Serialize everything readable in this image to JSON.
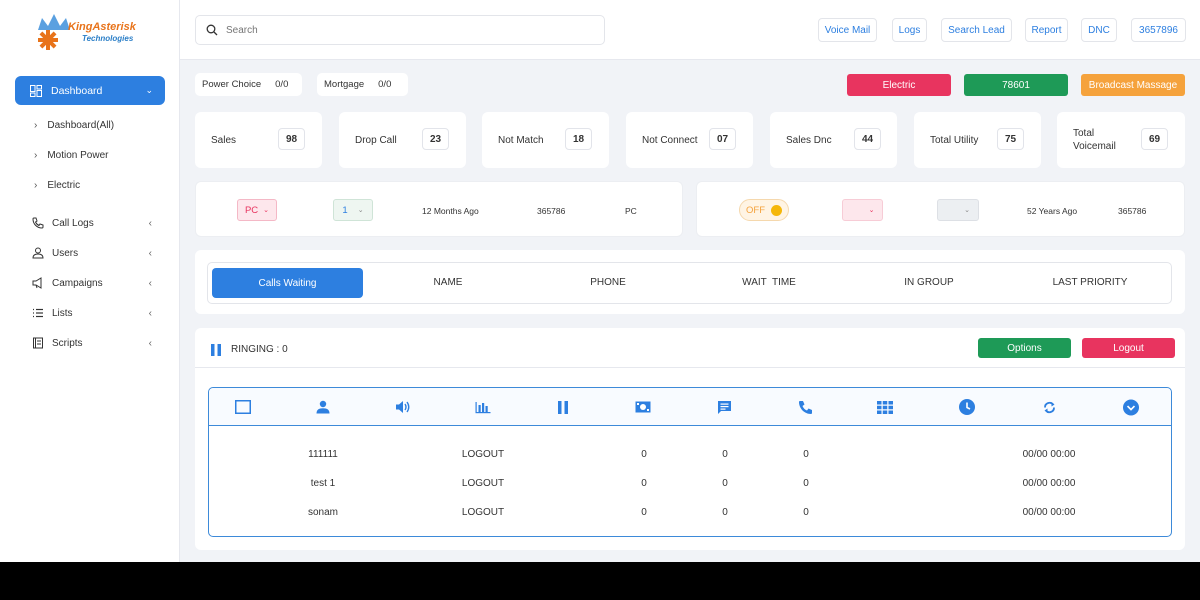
{
  "brand": {
    "name": "KingAsterisk",
    "sub": "Technologies"
  },
  "sidebar": {
    "active": {
      "label": "Dashboard"
    },
    "sub_items": [
      {
        "label": "Dashboard(All)"
      },
      {
        "label": "Motion Power"
      },
      {
        "label": "Electric"
      }
    ],
    "items": [
      {
        "label": "Call Logs",
        "icon": "phone-icon"
      },
      {
        "label": "Users",
        "icon": "user-icon"
      },
      {
        "label": "Campaigns",
        "icon": "megaphone-icon"
      },
      {
        "label": "Lists",
        "icon": "list-icon"
      },
      {
        "label": "Scripts",
        "icon": "script-icon"
      }
    ]
  },
  "topbar": {
    "search_placeholder": "Search",
    "buttons": [
      {
        "label": "Voice Mail"
      },
      {
        "label": "Logs"
      },
      {
        "label": "Search Lead"
      },
      {
        "label": "Report"
      },
      {
        "label": "DNC"
      },
      {
        "label": "3657896"
      }
    ]
  },
  "queues": [
    {
      "label": "Power Choice",
      "count": "0/0"
    },
    {
      "label": "Mortgage",
      "count": "0/0"
    }
  ],
  "campaign_buttons": {
    "electric": "Electric",
    "number": "78601",
    "broadcast": "Broadcast Massage"
  },
  "stats": [
    {
      "label": "Sales",
      "value": "98"
    },
    {
      "label": "Drop Call",
      "value": "23"
    },
    {
      "label": "Not Match",
      "value": "18"
    },
    {
      "label": "Not Connect",
      "value": "07"
    },
    {
      "label": "Sales Dnc",
      "value": "44"
    },
    {
      "label": "Total Utility",
      "value": "75"
    },
    {
      "label": "Total\nVoicemail",
      "value": "69"
    }
  ],
  "panel_left": {
    "pc_select": "PC",
    "num_select": "1",
    "time": "12 Months Ago",
    "number": "365786",
    "tag": "PC"
  },
  "panel_right": {
    "toggle": "OFF",
    "time": "52 Years Ago",
    "number": "365786"
  },
  "queue_header": {
    "tab": "Calls Waiting",
    "columns": [
      "NAME",
      "PHONE",
      "WAIT  TIME",
      "IN GROUP",
      "LAST PRIORITY"
    ]
  },
  "agents": {
    "ringing": "RINGING : 0",
    "options_label": "Options",
    "logout_label": "Logout",
    "icons": [
      "checkbox-icon",
      "user-icon",
      "speaker-icon",
      "bar-chart-icon",
      "pause-icon",
      "money-icon",
      "chat-icon",
      "phone-icon",
      "dialpad-icon",
      "clock-icon",
      "refresh-icon",
      "chevron-down-icon"
    ],
    "rows": [
      {
        "id": "111111",
        "status": "LOGOUT",
        "a": "0",
        "b": "0",
        "c": "0",
        "time": "00/00 00:00"
      },
      {
        "id": "test 1",
        "status": "LOGOUT",
        "a": "0",
        "b": "0",
        "c": "0",
        "time": "00/00 00:00"
      },
      {
        "id": "sonam",
        "status": "LOGOUT",
        "a": "0",
        "b": "0",
        "c": "0",
        "time": "00/00 00:00"
      }
    ]
  },
  "colors": {
    "primary": "#2d7fe0",
    "danger": "#e8345f",
    "success": "#1e9a57",
    "warning": "#f5a23c"
  }
}
